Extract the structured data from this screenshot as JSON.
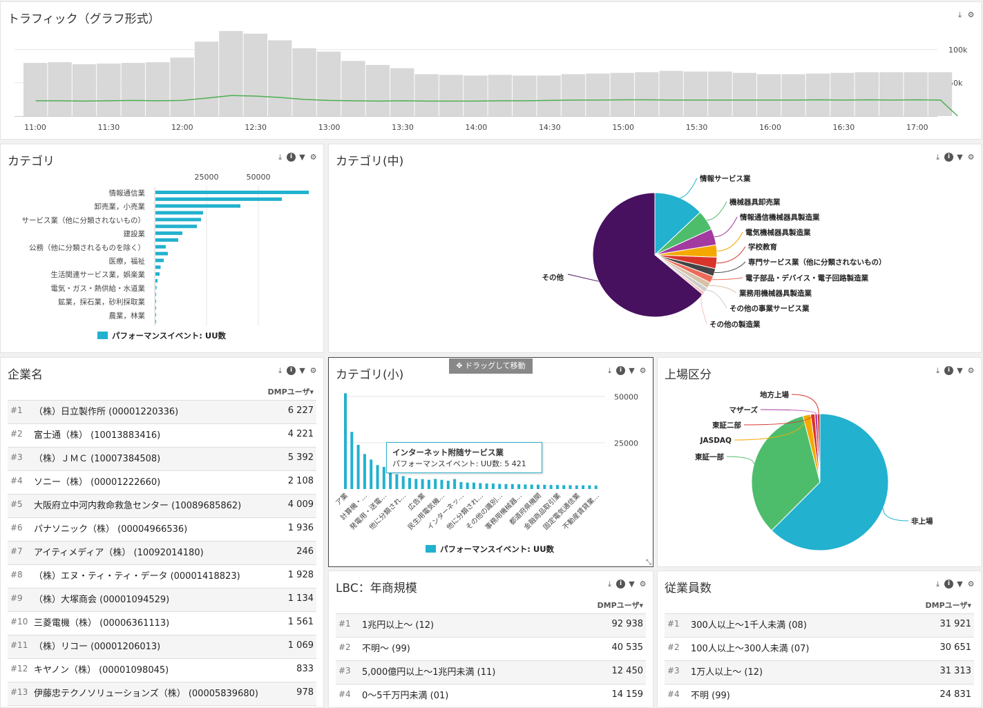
{
  "colors": {
    "accent": "#22b1cf",
    "bar_gray": "#d8d8d8",
    "line_green": "#4caf50",
    "purple": "#471160",
    "green": "#4dbd6c",
    "magenta": "#a23aa0",
    "orange": "#f5a800",
    "red": "#d9342a",
    "darkgray": "#444444",
    "salmon": "#ee6a5a",
    "tan": "#d7c1a8",
    "lightgray": "#cccccc",
    "pink": "#f7c1c1"
  },
  "toolbar_icons": [
    "download-icon",
    "info-icon",
    "filter-icon",
    "gear-icon"
  ],
  "traffic": {
    "title": "トラフィック（グラフ形式）",
    "chart_data": {
      "type": "bar",
      "x_labels": [
        "11:00",
        "11:30",
        "12:00",
        "12:30",
        "13:00",
        "13:30",
        "14:00",
        "14:30",
        "15:00",
        "15:30",
        "16:00",
        "16:30",
        "17:00"
      ],
      "y_ticks": [
        "100k",
        "50k"
      ],
      "ylim": [
        0,
        130000
      ],
      "bars": [
        80000,
        81000,
        78000,
        79000,
        80000,
        81000,
        88000,
        112000,
        128000,
        124000,
        114000,
        102000,
        97000,
        83000,
        77000,
        72000,
        63000,
        62000,
        61000,
        62000,
        61000,
        61000,
        63000,
        64000,
        65000,
        66000,
        68000,
        67000,
        67000,
        65000,
        63000,
        63000,
        64000,
        65000,
        66000,
        66000,
        66000,
        66000
      ],
      "line": [
        23000,
        23000,
        22500,
        23000,
        23500,
        23000,
        23500,
        27000,
        31000,
        30000,
        28000,
        25000,
        23500,
        23000,
        22500,
        23000,
        22500,
        22500,
        22500,
        23000,
        23000,
        23500,
        24000,
        24000,
        24500,
        24500,
        24000,
        24000,
        24000,
        24000,
        24000,
        24000,
        24500,
        24000,
        24500,
        24000,
        24500,
        24000,
        0
      ]
    }
  },
  "category": {
    "title": "カテゴリ",
    "chart_data": {
      "type": "bar",
      "orientation": "horizontal",
      "x_ticks": [
        "25000",
        "50000"
      ],
      "xlim": [
        0,
        75000
      ],
      "labels": [
        "情報通信業",
        "",
        "卸売業，小売業",
        "",
        "サービス業（他に分類されないもの）",
        "",
        "建設業",
        "",
        "公務（他に分類されるものを除く）",
        "",
        "医療，福祉",
        "",
        "生活関連サービス業，娯楽業",
        "",
        "電気・ガス・熱供給・水道業",
        "",
        "鉱業，採石業，砂利採取業",
        "",
        "農業，林業",
        ""
      ],
      "values": [
        74000,
        61000,
        41000,
        23000,
        22000,
        20000,
        13000,
        11000,
        5000,
        6000,
        4000,
        2500,
        2000,
        1000,
        500,
        300,
        300,
        200,
        100,
        80
      ],
      "legend": "パフォーマンスイベント: UU数"
    }
  },
  "category_mid": {
    "title": "カテゴリ(中)",
    "chart_data": {
      "type": "pie",
      "labels": [
        "情報サービス業",
        "機械器具卸売業",
        "情報通信機械器具製造業",
        "電気機械器具製造業",
        "学校教育",
        "専門サービス業（他に分類されないもの）",
        "電子部品・デバイス・電子回路製造業",
        "業務用機械器具製造業",
        "その他の事業サービス業",
        "その他の製造業",
        "その他"
      ],
      "values": [
        13.0,
        5.2,
        4.2,
        3.2,
        3.0,
        2.0,
        1.8,
        1.6,
        1.2,
        0.8,
        64.0
      ]
    }
  },
  "company": {
    "title": "企業名",
    "column": "DMPユーザ▾",
    "rows": [
      {
        "rank": "#1",
        "name": "（株）日立製作所 (00001220336)",
        "value": "6 227"
      },
      {
        "rank": "#2",
        "name": "富士通（株） (10013883416)",
        "value": "4 221"
      },
      {
        "rank": "#3",
        "name": "（株）ＪＭＣ (10007384508)",
        "value": "5 392"
      },
      {
        "rank": "#4",
        "name": "ソニー（株） (00001222660)",
        "value": "2 108"
      },
      {
        "rank": "#5",
        "name": "大阪府立中河内救命救急センター (10089685862)",
        "value": "4 009"
      },
      {
        "rank": "#6",
        "name": "パナソニック（株） (00004966536)",
        "value": "1 936"
      },
      {
        "rank": "#7",
        "name": "アイティメディア（株） (10092014180)",
        "value": "246"
      },
      {
        "rank": "#8",
        "name": "（株）エヌ・ティ・ティ・データ (00001418823)",
        "value": "1 928"
      },
      {
        "rank": "#9",
        "name": "（株）大塚商会 (00001094529)",
        "value": "1 134"
      },
      {
        "rank": "#10",
        "name": "三菱電機（株） (00006361113)",
        "value": "1 561"
      },
      {
        "rank": "#11",
        "name": "（株）リコー (00001206013)",
        "value": "1 069"
      },
      {
        "rank": "#12",
        "name": "キヤノン（株） (00001098045)",
        "value": "833"
      },
      {
        "rank": "#13",
        "name": "伊藤忠テクノソリューションズ（株） (00005839680)",
        "value": "978"
      }
    ]
  },
  "category_small": {
    "title": "カテゴリ(小)",
    "drag_label": "✥ ドラッグして移動",
    "tooltip_title": "インターネット附随サービス業",
    "tooltip_value": "パフォーマンスイベント: UU数: 5 421",
    "chart_data": {
      "type": "bar",
      "y_ticks": [
        "50000",
        "25000"
      ],
      "ylim": [
        0,
        60000
      ],
      "values": [
        52000,
        31000,
        24000,
        19000,
        16000,
        13000,
        12000,
        10000,
        8000,
        7000,
        6000,
        5500,
        5400,
        5000,
        5500,
        5000,
        4500,
        5421,
        3800,
        3500,
        3500,
        3200,
        3000,
        3000,
        2800,
        2700,
        2700,
        2600,
        2500,
        2400,
        2400,
        2300,
        2200,
        2200,
        2100,
        2100,
        2000,
        2000,
        2000,
        1900
      ],
      "x_labels": [
        "ア業",
        "計算機・…",
        "発電用・送電…",
        "他に分類され…",
        "広告業",
        "民生用電気機…",
        "インターネッ…",
        "他に分類され…",
        "その他の識別…",
        "事務用機械器…",
        "都道府県機関",
        "金融商品取引業",
        "固定電気通信業",
        "不動産賃貸業…"
      ],
      "legend": "パフォーマンスイベント: UU数"
    }
  },
  "listing": {
    "title": "上場区分",
    "chart_data": {
      "type": "pie",
      "labels": [
        "非上場",
        "東証一部",
        "JASDAQ",
        "東証二部",
        "マザーズ",
        "地方上場"
      ],
      "values": [
        62.5,
        33.5,
        1.8,
        1.0,
        0.6,
        0.6
      ]
    }
  },
  "revenue": {
    "title": "LBC：年商規模",
    "column": "DMPユーザ▾",
    "rows": [
      {
        "rank": "#1",
        "name": "1兆円以上〜 (12)",
        "value": "92 938"
      },
      {
        "rank": "#2",
        "name": "不明〜 (99)",
        "value": "40 535"
      },
      {
        "rank": "#3",
        "name": "5,000億円以上〜1兆円未満 (11)",
        "value": "12 450"
      },
      {
        "rank": "#4",
        "name": "0〜5千万円未満 (01)",
        "value": "14 159"
      }
    ]
  },
  "employees": {
    "title": "従業員数",
    "column": "DMPユーザ▾",
    "rows": [
      {
        "rank": "#1",
        "name": "300人以上〜1千人未満 (08)",
        "value": "31 921"
      },
      {
        "rank": "#2",
        "name": "100人以上〜300人未満 (07)",
        "value": "30 651"
      },
      {
        "rank": "#3",
        "name": "1万人以上〜 (12)",
        "value": "31 313"
      },
      {
        "rank": "#4",
        "name": "不明 (99)",
        "value": "24 831"
      }
    ]
  }
}
